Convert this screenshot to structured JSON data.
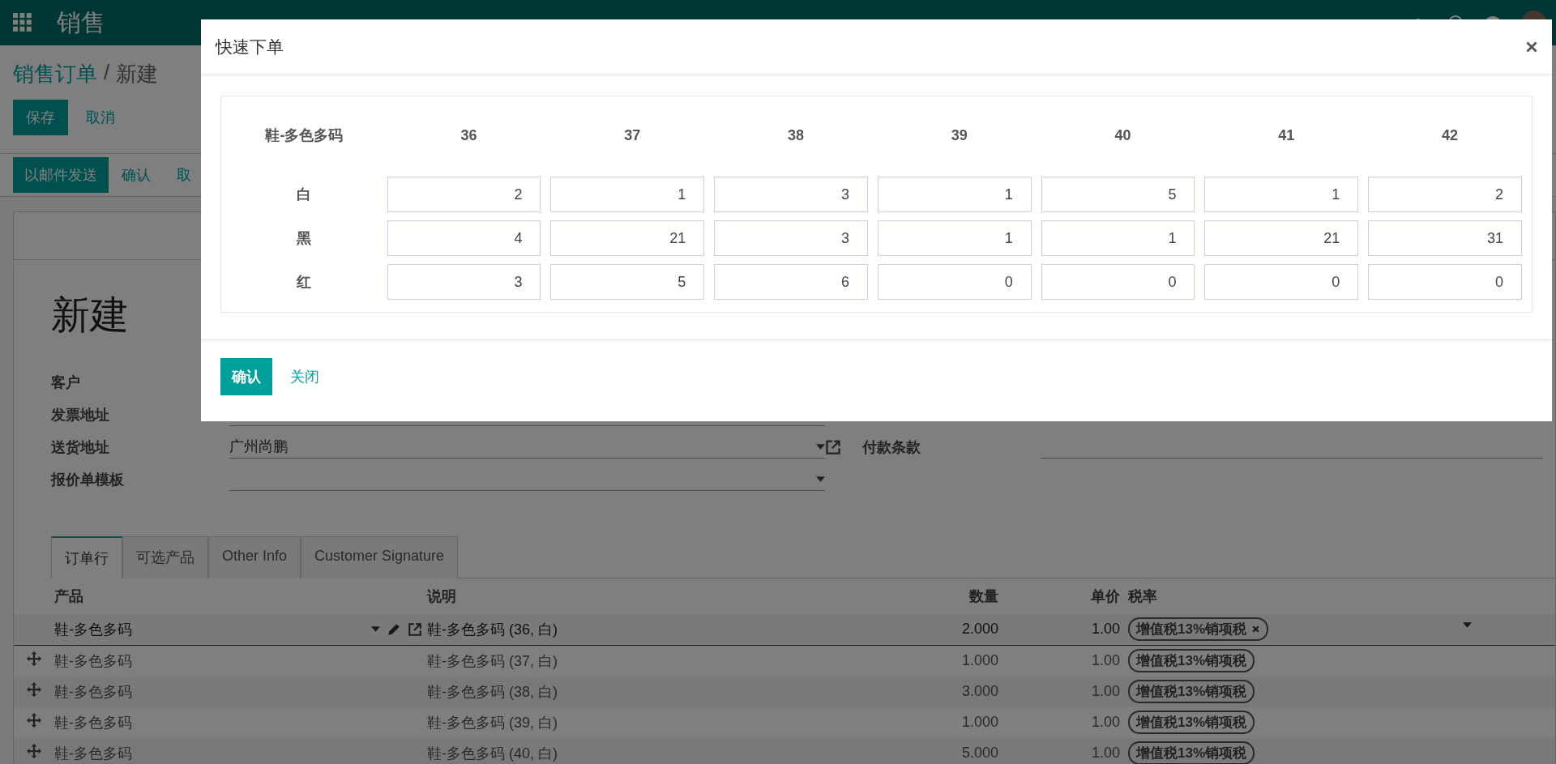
{
  "navbar": {
    "app_title": "销售"
  },
  "breadcrumb": {
    "parent": "销售订单",
    "separator": "/",
    "current": "新建"
  },
  "buttons": [
    "保存",
    "取消"
  ],
  "status_buttons": [
    {
      "label": "以邮件发送",
      "kind": "primary"
    },
    {
      "label": "确认",
      "kind": "link"
    },
    {
      "label": "取",
      "kind": "link"
    }
  ],
  "form": {
    "title": "新建",
    "left_fields": [
      {
        "label": "客户"
      },
      {
        "label": "发票地址",
        "kind": "text"
      },
      {
        "label": "送货地址",
        "kind": "select",
        "value": "广州尚鹏"
      },
      {
        "label": "报价单模板",
        "kind": "select"
      }
    ],
    "right_fields": [
      {
        "label": "付款条款"
      }
    ]
  },
  "tabs": [
    {
      "label": "订单行",
      "selected": true
    },
    {
      "label": "可选产品",
      "selected": false
    },
    {
      "label": "Other Info",
      "selected": false
    },
    {
      "label": "Customer Signature",
      "selected": false
    }
  ],
  "order_lines": {
    "columns": [
      "产品",
      "说明",
      "数量",
      "单价",
      "税率"
    ],
    "rows": [
      {
        "kind": "editing",
        "product": "鞋-多色多码",
        "description": "鞋-多色多码 (36, 白)",
        "quantity": "2.000",
        "price": "1.00",
        "tax": "增值税13%销项税"
      },
      {
        "kind": "line",
        "product": "鞋-多色多码",
        "description": "鞋-多色多码 (37, 白)",
        "quantity": "1.000",
        "price": "1.00",
        "tax": "增值税13%销项税"
      },
      {
        "kind": "line",
        "product": "鞋-多色多码",
        "description": "鞋-多色多码 (38, 白)",
        "quantity": "3.000",
        "price": "1.00",
        "tax": "增值税13%销项税"
      },
      {
        "kind": "line",
        "product": "鞋-多色多码",
        "description": "鞋-多色多码 (39, 白)",
        "quantity": "1.000",
        "price": "1.00",
        "tax": "增值税13%销项税"
      },
      {
        "kind": "line",
        "product": "鞋-多色多码",
        "description": "鞋-多色多码 (40, 白)",
        "quantity": "5.000",
        "price": "1.00",
        "tax": "增值税13%销项税"
      }
    ]
  },
  "dialog": {
    "title": "快速下单",
    "grid": {
      "corner": "鞋-多色多码",
      "sizes": [
        "36",
        "37",
        "38",
        "39",
        "40",
        "41",
        "42"
      ],
      "rows": [
        {
          "label": "白",
          "values": [
            "2",
            "1",
            "3",
            "1",
            "5",
            "1",
            "2"
          ]
        },
        {
          "label": "黑",
          "values": [
            "4",
            "21",
            "3",
            "1",
            "1",
            "21",
            "31"
          ]
        },
        {
          "label": "红",
          "values": [
            "3",
            "5",
            "6",
            "0",
            "0",
            "0",
            "0"
          ]
        }
      ]
    },
    "buttons": [
      {
        "label": "确认",
        "kind": "primary"
      },
      {
        "label": "关闭",
        "kind": "link"
      }
    ]
  }
}
